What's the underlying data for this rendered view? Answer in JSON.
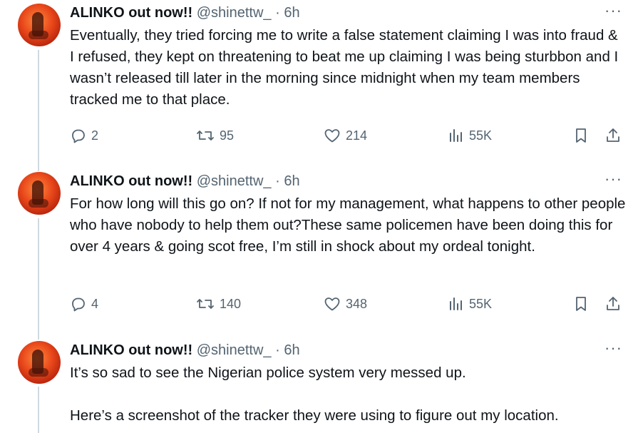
{
  "tweets": [
    {
      "name": "ALINKO out now!!",
      "handle": "@shinettw_",
      "dot": "·",
      "time": "6h",
      "text": "Eventually, they tried forcing me to write a false statement claiming I was into fraud & I refused, they kept on threatening to beat me up claiming I was being sturbbon and I wasn’t released till later in the morning since midnight when my team members tracked me to that place.",
      "replies": "2",
      "retweets": "95",
      "likes": "214",
      "views": "55K"
    },
    {
      "name": "ALINKO out now!!",
      "handle": "@shinettw_",
      "dot": "·",
      "time": "6h",
      "text": "For how long will this go on? If not for my management, what happens to other people who have nobody to help them out?These same policemen have been doing this for over 4 years & going scot free, I’m still in shock about my ordeal tonight.",
      "replies": "4",
      "retweets": "140",
      "likes": "348",
      "views": "55K"
    },
    {
      "name": "ALINKO out now!!",
      "handle": "@shinettw_",
      "dot": "·",
      "time": "6h",
      "text": "It’s so sad to see the Nigerian police system very messed up.\n\nHere’s a screenshot of the tracker they were using to figure out my location."
    }
  ],
  "more_label": "···",
  "icons": [
    "reply-icon",
    "retweet-icon",
    "like-icon",
    "views-icon",
    "bookmark-icon",
    "share-icon"
  ]
}
